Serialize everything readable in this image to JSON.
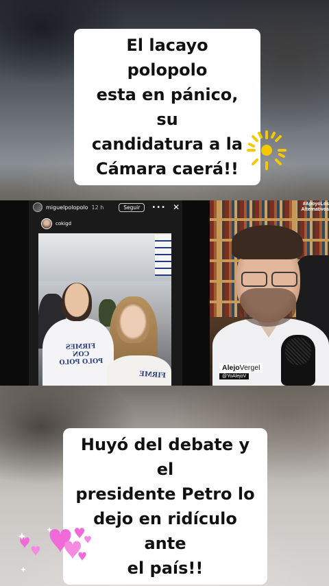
{
  "captions": {
    "top": [
      "El lacayo polopolo",
      "esta en pánico, su",
      "candidatura a la",
      "Cámara caerá!!"
    ],
    "bottom": [
      "Huyó del debate y el",
      "presidente Petro lo",
      "dejo en ridículo ante",
      "el país!!"
    ]
  },
  "story": {
    "username": "miguelpolopolo",
    "time": "12 h",
    "follow_label": "Seguir",
    "more_icon": "more-icon",
    "close_icon": "close-icon",
    "sub_username": "cokigd",
    "shirt_text": [
      "FIRMES",
      "CON",
      "POLO POLO"
    ],
    "shirt_text_2": "FIRME"
  },
  "streamer": {
    "first_name": "Alejo",
    "last_name": "Vergel",
    "handle": "@YoAlejoV"
  },
  "watermark": [
    "#ApoyoLos",
    "Alternativos"
  ],
  "colors": {
    "caption_bg": "#ffffff",
    "sun": "#f5c800",
    "hearts": "#f06bd8"
  },
  "icons": {
    "sun": "sun-icon",
    "hearts": "hearts-icon"
  }
}
